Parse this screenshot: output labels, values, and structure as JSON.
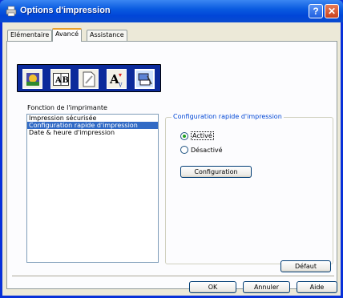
{
  "window": {
    "title": "Options d'impression",
    "help_label": "?",
    "close_label": "✕"
  },
  "tabs": [
    {
      "label": "Elémentaire",
      "active": false
    },
    {
      "label": "Avancé",
      "active": true
    },
    {
      "label": "Assistance",
      "active": false
    }
  ],
  "toolbar": {
    "icons": [
      "color-settings-icon",
      "layout-ab-icon",
      "watermark-icon",
      "font-a-icon",
      "printer-function-icon"
    ],
    "selected_index": 4
  },
  "printer_function": {
    "label": "Fonction de l'imprimante",
    "items": [
      "Impression sécurisée",
      "Configuration rapide d'impression",
      "Date & heure d'impression"
    ],
    "selected_index": 1
  },
  "quick_print": {
    "title": "Configuration rapide d'impression",
    "option_on": "Activé",
    "option_off": "Désactivé",
    "selected": "Activé",
    "config_button": "Configuration"
  },
  "footer": {
    "default_button": "Défaut",
    "ok_button": "OK",
    "cancel_button": "Annuler",
    "help_button": "Aide"
  },
  "colors": {
    "titlebar": "#0a5be0",
    "selection": "#316ac5",
    "group_title": "#0046d5"
  }
}
